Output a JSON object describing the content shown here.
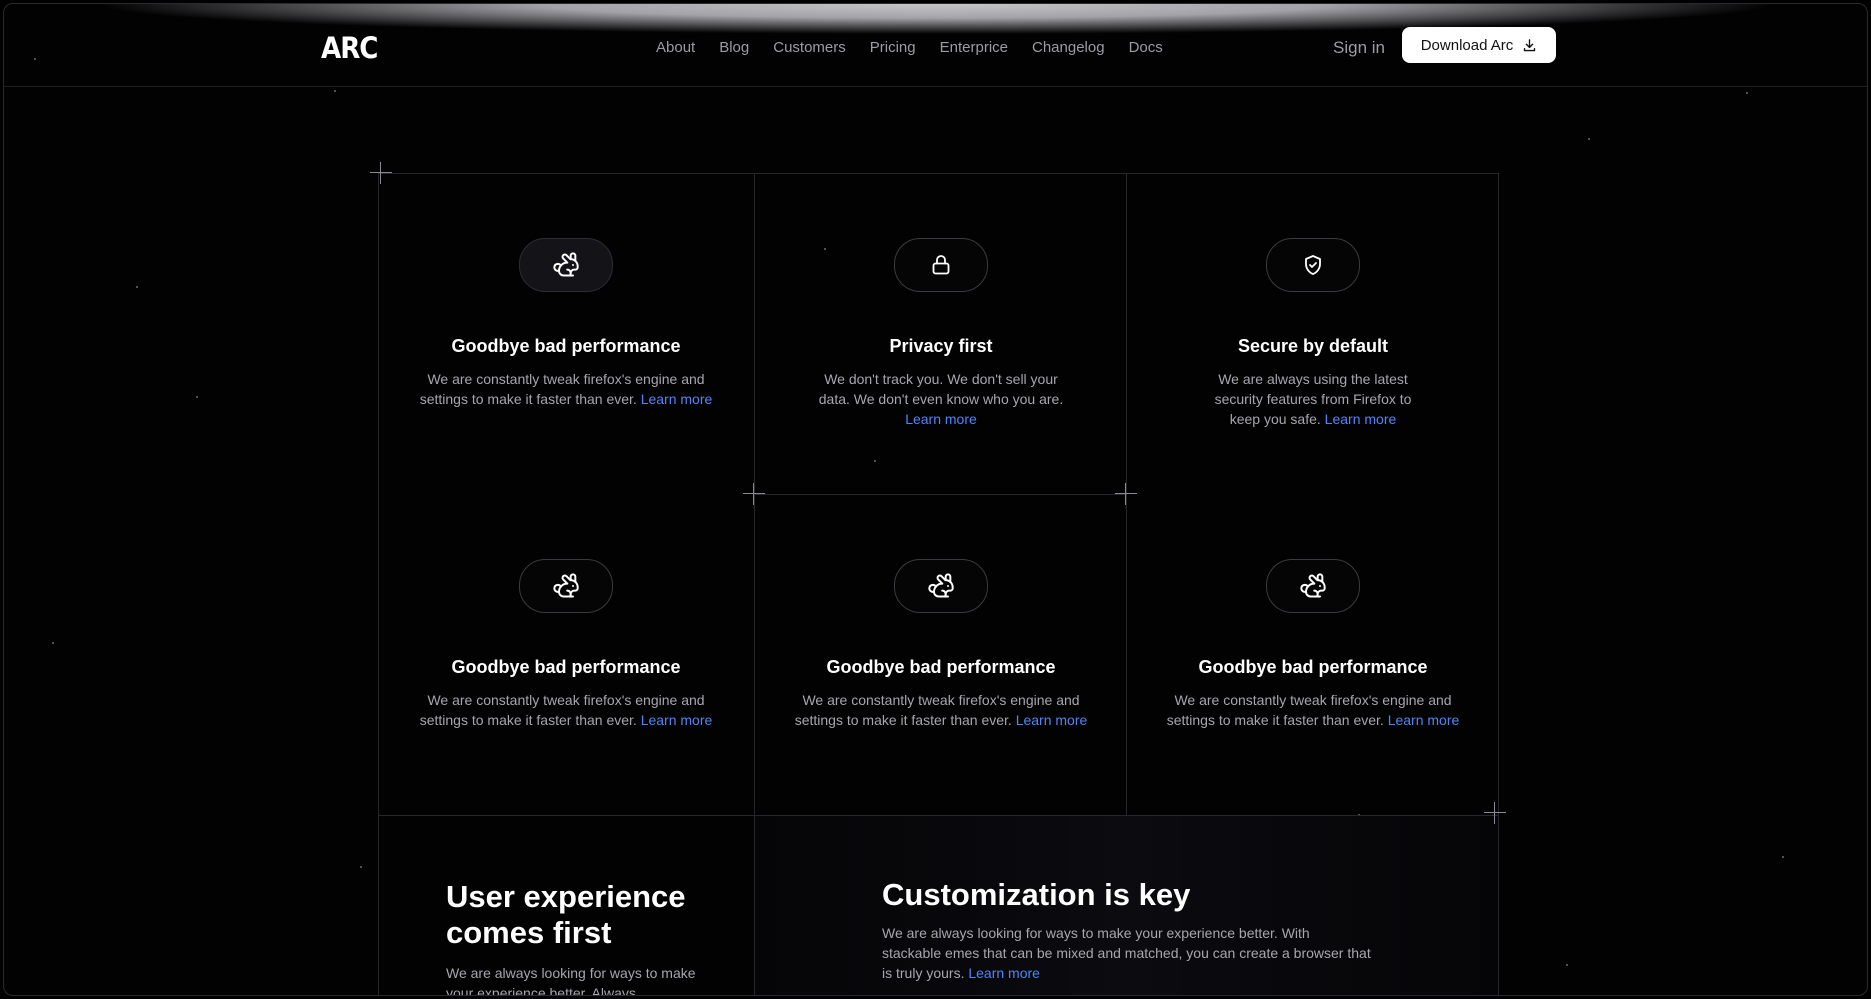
{
  "header": {
    "logo": "ARC",
    "nav": [
      "About",
      "Blog",
      "Customers",
      "Pricing",
      "Enterprice",
      "Changelog",
      "Docs"
    ],
    "signin": "Sign in",
    "download": "Download Arc"
  },
  "cards": [
    {
      "icon": "rabbit-icon",
      "title": "Goodbye bad performance",
      "text": "We are constantly tweak firefox's engine and settings to make it faster than ever.",
      "link": "Learn more"
    },
    {
      "icon": "lock-icon",
      "title": "Privacy first",
      "text": "We don't track you. We don't sell your data. We don't even know who you are.",
      "link": "Learn more"
    },
    {
      "icon": "shield-check-icon",
      "title": "Secure by default",
      "text": "We are always using the latest security features from Firefox to keep you safe.",
      "link": "Learn more"
    },
    {
      "icon": "rabbit-icon",
      "title": "Goodbye bad performance",
      "text": "We are constantly tweak firefox's engine and settings to make it faster than ever.",
      "link": "Learn more"
    },
    {
      "icon": "rabbit-icon",
      "title": "Goodbye bad performance",
      "text": "We are constantly tweak firefox's engine and settings to make it faster than ever.",
      "link": "Learn more"
    },
    {
      "icon": "rabbit-icon",
      "title": "Goodbye bad performance",
      "text": "We are constantly tweak firefox's engine and settings to make it faster than ever.",
      "link": "Learn more"
    }
  ],
  "feature_left": {
    "title": "User experience comes first",
    "text": "We are always looking for ways to make your experience better. Always"
  },
  "feature_right": {
    "title": "Customization is key",
    "text": "We are always looking for ways to make your experience better. With stackable emes that can be mixed and matched, you can create a browser that is truly yours.",
    "link": "Learn more"
  },
  "colors": {
    "accent": "#4f86f7",
    "background": "#000000",
    "border": "#26262b"
  }
}
